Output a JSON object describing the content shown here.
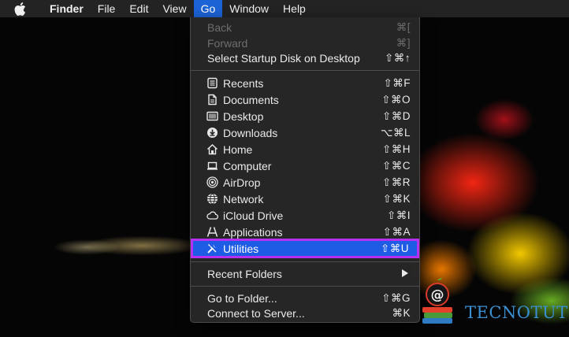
{
  "menubar": {
    "app_name": "Finder",
    "items": [
      "File",
      "Edit",
      "View",
      "Go",
      "Window",
      "Help"
    ],
    "active": "Go"
  },
  "go_menu": {
    "back": {
      "label": "Back",
      "shortcut": "⌘["
    },
    "forward": {
      "label": "Forward",
      "shortcut": "⌘]"
    },
    "startup": {
      "label": "Select Startup Disk on Desktop",
      "shortcut": "⇧⌘↑"
    },
    "items": [
      {
        "label": "Recents",
        "shortcut": "⇧⌘F",
        "icon": "recents-icon"
      },
      {
        "label": "Documents",
        "shortcut": "⇧⌘O",
        "icon": "documents-icon"
      },
      {
        "label": "Desktop",
        "shortcut": "⇧⌘D",
        "icon": "desktop-icon"
      },
      {
        "label": "Downloads",
        "shortcut": "⌥⌘L",
        "icon": "downloads-icon"
      },
      {
        "label": "Home",
        "shortcut": "⇧⌘H",
        "icon": "home-icon"
      },
      {
        "label": "Computer",
        "shortcut": "⇧⌘C",
        "icon": "computer-icon"
      },
      {
        "label": "AirDrop",
        "shortcut": "⇧⌘R",
        "icon": "airdrop-icon"
      },
      {
        "label": "Network",
        "shortcut": "⇧⌘K",
        "icon": "network-icon"
      },
      {
        "label": "iCloud Drive",
        "shortcut": "⇧⌘I",
        "icon": "icloud-icon"
      },
      {
        "label": "Applications",
        "shortcut": "⇧⌘A",
        "icon": "applications-icon"
      },
      {
        "label": "Utilities",
        "shortcut": "⇧⌘U",
        "icon": "utilities-icon"
      }
    ],
    "recent_folders": {
      "label": "Recent Folders"
    },
    "go_to_folder": {
      "label": "Go to Folder...",
      "shortcut": "⇧⌘G"
    },
    "connect": {
      "label": "Connect to Server...",
      "shortcut": "⌘K"
    }
  },
  "colors": {
    "highlight": "#1e5ce6",
    "highlight_outline": "#b530f0",
    "menu_bg": "#282828"
  },
  "watermark": {
    "text": "TECNOTUTO"
  }
}
